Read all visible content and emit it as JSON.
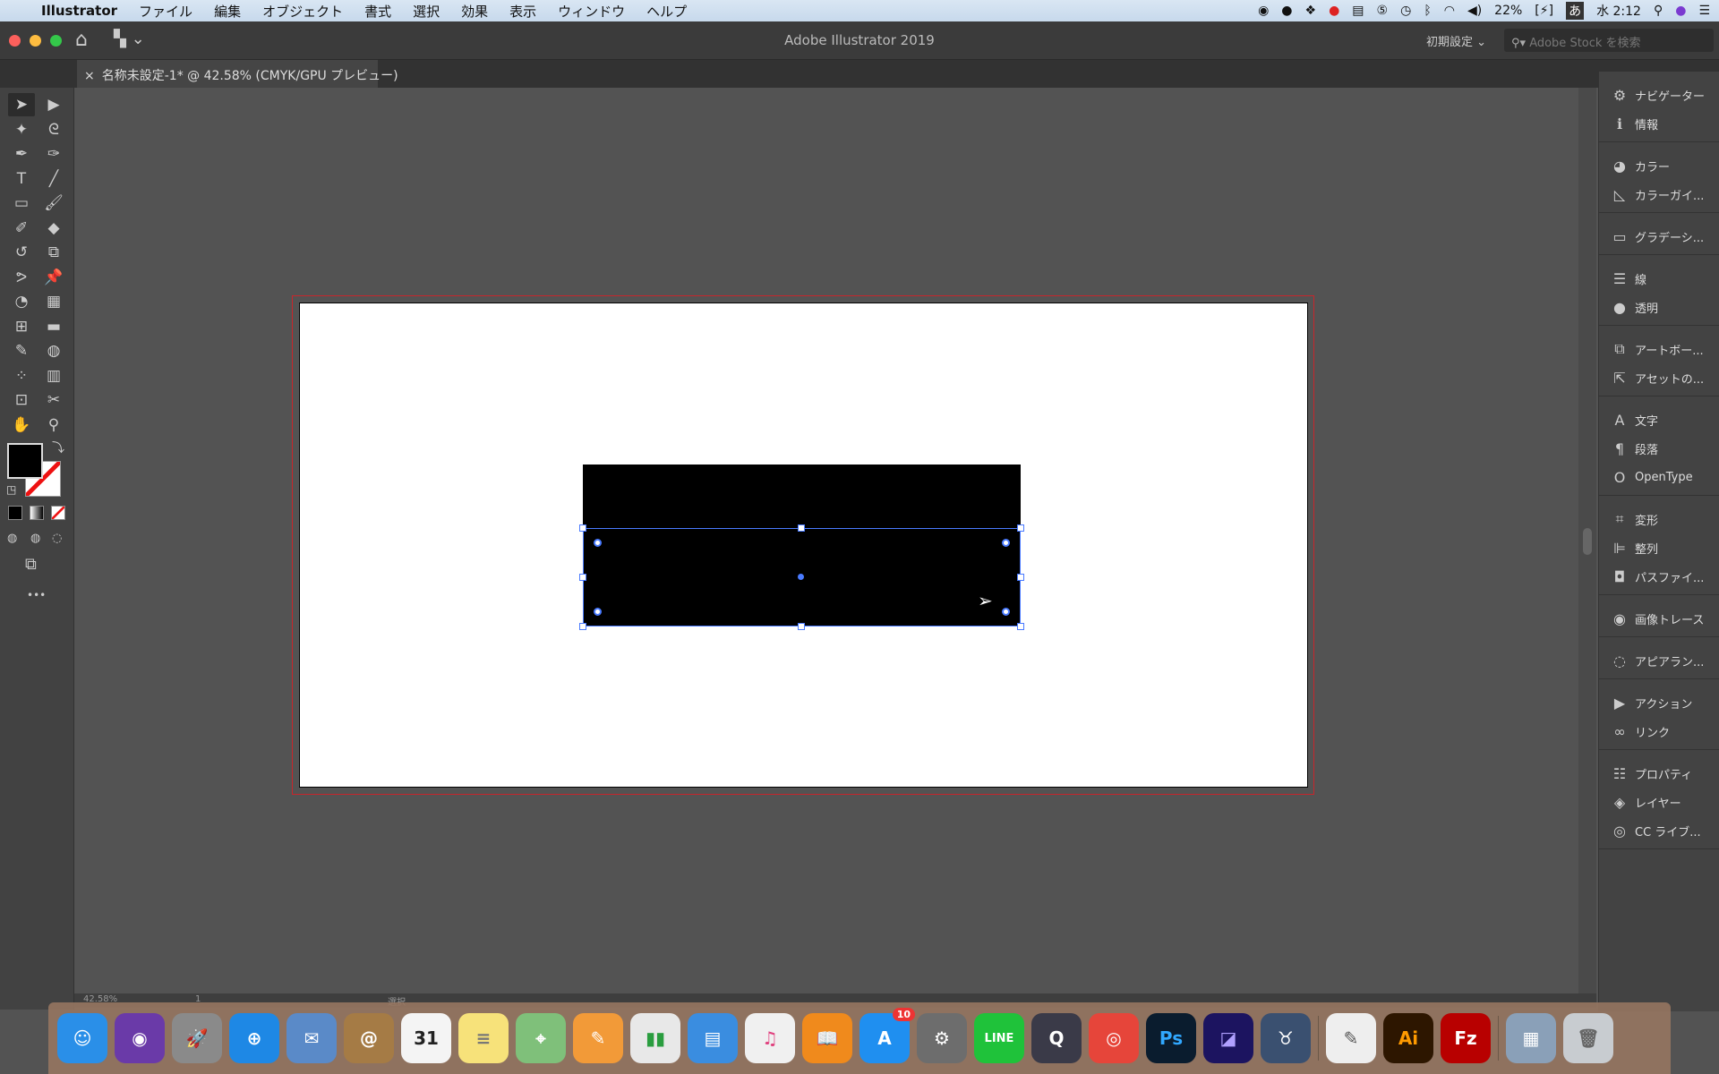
{
  "menubar": {
    "apple": "",
    "app": "Illustrator",
    "items": [
      "ファイル",
      "編集",
      "オブジェクト",
      "書式",
      "選択",
      "効果",
      "表示",
      "ウィンドウ",
      "ヘルプ"
    ],
    "status": {
      "battery": "22%",
      "ime": "あ",
      "clock": "水 2:12"
    }
  },
  "window": {
    "title": "Adobe Illustrator 2019",
    "workspace": "初期設定",
    "stock_placeholder": "Adobe Stock を検索"
  },
  "document": {
    "tab_label": "名称未設定-1* @ 42.58% (CMYK/GPU プレビュー)",
    "close": "×",
    "zoom": "42.58%",
    "page": "1",
    "status": "選択"
  },
  "toolbar": {
    "tools": [
      "selection",
      "direct-selection",
      "magic-wand",
      "lasso",
      "pen",
      "curvature",
      "type",
      "line",
      "rectangle",
      "paintbrush",
      "shaper",
      "eraser",
      "rotate",
      "scale",
      "warp",
      "puppet-warp",
      "shape-builder",
      "perspective-grid",
      "mesh",
      "gradient",
      "eyedropper",
      "blend",
      "symbol-sprayer",
      "column-graph",
      "artboard",
      "slice",
      "hand",
      "zoom"
    ],
    "fill_color": "#000000",
    "stroke": "none",
    "more": "•••"
  },
  "panels": [
    {
      "items": [
        {
          "icon": "navigator-icon",
          "label": "ナビゲーター",
          "glyph": "⚙"
        },
        {
          "icon": "info-icon",
          "label": "情報",
          "glyph": "ℹ"
        }
      ]
    },
    {
      "items": [
        {
          "icon": "color-icon",
          "label": "カラー",
          "glyph": "◕"
        },
        {
          "icon": "color-guide-icon",
          "label": "カラーガイ...",
          "glyph": "◺"
        }
      ]
    },
    {
      "items": [
        {
          "icon": "gradient-icon",
          "label": "グラデーシ...",
          "glyph": "▭"
        }
      ]
    },
    {
      "items": [
        {
          "icon": "stroke-icon",
          "label": "線",
          "glyph": "☰"
        },
        {
          "icon": "transparency-icon",
          "label": "透明",
          "glyph": "●"
        }
      ]
    },
    {
      "items": [
        {
          "icon": "artboards-icon",
          "label": "アートボー...",
          "glyph": "⧉"
        },
        {
          "icon": "asset-export-icon",
          "label": "アセットの...",
          "glyph": "⇱"
        }
      ]
    },
    {
      "items": [
        {
          "icon": "character-icon",
          "label": "文字",
          "glyph": "A"
        },
        {
          "icon": "paragraph-icon",
          "label": "段落",
          "glyph": "¶"
        },
        {
          "icon": "opentype-icon",
          "label": "OpenType",
          "glyph": "O"
        }
      ]
    },
    {
      "items": [
        {
          "icon": "transform-icon",
          "label": "変形",
          "glyph": "⌗"
        },
        {
          "icon": "align-icon",
          "label": "整列",
          "glyph": "⊫"
        },
        {
          "icon": "pathfinder-icon",
          "label": "パスファイ...",
          "glyph": "◘"
        }
      ]
    },
    {
      "items": [
        {
          "icon": "image-trace-icon",
          "label": "画像トレース",
          "glyph": "◉"
        }
      ]
    },
    {
      "items": [
        {
          "icon": "appearance-icon",
          "label": "アピアラン...",
          "glyph": "◌"
        }
      ]
    },
    {
      "items": [
        {
          "icon": "actions-icon",
          "label": "アクション",
          "glyph": "▶"
        },
        {
          "icon": "links-icon",
          "label": "リンク",
          "glyph": "∞"
        }
      ]
    },
    {
      "items": [
        {
          "icon": "properties-icon",
          "label": "プロパティ",
          "glyph": "☷"
        },
        {
          "icon": "layers-icon",
          "label": "レイヤー",
          "glyph": "◈"
        },
        {
          "icon": "cc-libraries-icon",
          "label": "CC ライブ...",
          "glyph": "◎"
        }
      ]
    }
  ],
  "colors": {
    "selection": "#4a7bff",
    "bleed": "#c8252b"
  },
  "dock": [
    {
      "name": "finder",
      "bg": "#2a8fe8",
      "t": "☺"
    },
    {
      "name": "siri",
      "bg": "#6a3aa8",
      "t": "◉"
    },
    {
      "name": "launchpad",
      "bg": "#8a8a8a",
      "t": "🚀"
    },
    {
      "name": "safari",
      "bg": "#1e88e5",
      "t": "⊕"
    },
    {
      "name": "mail",
      "bg": "#5a8ac8",
      "t": "✉"
    },
    {
      "name": "contacts",
      "bg": "#a57b45",
      "t": "@"
    },
    {
      "name": "calendar",
      "bg": "#f4f4f4",
      "t": "31",
      "c": "#222"
    },
    {
      "name": "notes",
      "bg": "#f7e27a",
      "t": "≡",
      "c": "#777"
    },
    {
      "name": "maps",
      "bg": "#7fc07a",
      "t": "⌖"
    },
    {
      "name": "pages",
      "bg": "#f29a38",
      "t": "✎"
    },
    {
      "name": "numbers",
      "bg": "#e8e8e8",
      "t": "▮▮",
      "c": "#2a9d3f"
    },
    {
      "name": "keynote",
      "bg": "#3a8de0",
      "t": "▤"
    },
    {
      "name": "itunes",
      "bg": "#f0f0f0",
      "t": "♫",
      "c": "#e0407e"
    },
    {
      "name": "books",
      "bg": "#f08a1c",
      "t": "📖"
    },
    {
      "name": "app-store",
      "bg": "#1f8ff0",
      "t": "A",
      "badge": "10"
    },
    {
      "name": "system-preferences",
      "bg": "#6d6d6d",
      "t": "⚙"
    },
    {
      "name": "line",
      "bg": "#1fc23a",
      "t": "LINE"
    },
    {
      "name": "quicktime",
      "bg": "#3a3a48",
      "t": "Q"
    },
    {
      "name": "chrome",
      "bg": "#e6453a",
      "t": "◎"
    },
    {
      "name": "photoshop",
      "bg": "#0a1c2e",
      "t": "Ps",
      "c": "#31a8ff"
    },
    {
      "name": "media-encoder",
      "bg": "#1c1460",
      "t": "◪",
      "c": "#b0a0ff"
    },
    {
      "name": "bull-app",
      "bg": "#3a5070",
      "t": "♉"
    },
    {
      "sep": true
    },
    {
      "name": "textedit",
      "bg": "#eeeeee",
      "t": "✎",
      "c": "#555"
    },
    {
      "name": "illustrator",
      "bg": "#2d1600",
      "t": "Ai",
      "c": "#ff9a00"
    },
    {
      "name": "filezilla",
      "bg": "#b80000",
      "t": "Fz"
    },
    {
      "sep": true
    },
    {
      "name": "photos-stack",
      "bg": "#8aa0b8",
      "t": "▦"
    },
    {
      "name": "trash",
      "bg": "#c8ccd0",
      "t": "🗑",
      "c": "#666"
    }
  ]
}
